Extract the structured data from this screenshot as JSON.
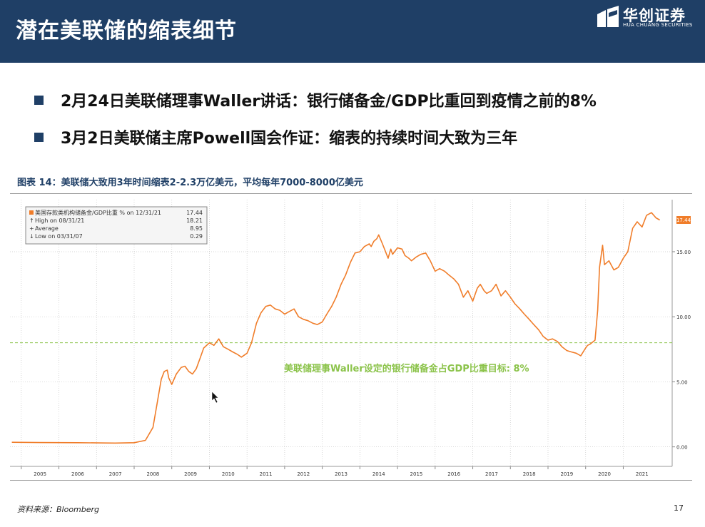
{
  "header": {
    "title": "潜在美联储的缩表细节",
    "logo_cn": "华创证券",
    "logo_en": "HUA CHUANG SECURITIES",
    "bg_color": "#1f3f66"
  },
  "bullets": [
    "2月24日美联储理事Waller讲话：银行储备金/GDP比重回到疫情之前的8%",
    "3月2日美联储主席Powell国会作证：缩表的持续时间大致为三年"
  ],
  "figure_caption": "图表 14：美联储大致用3年时间缩表2-2.3万亿美元，平均每年7000-8000亿美元",
  "chart_data": {
    "type": "line",
    "legend": {
      "series_label": "美国存款类机构储备金/GDP比重 % on 12/31/21",
      "last_value": "17.44",
      "high_label": "High on 08/31/21",
      "high_value": "18.21",
      "avg_label": "Average",
      "avg_value": "8.95",
      "low_label": "Low on 03/31/07",
      "low_value": "0.29"
    },
    "x_ticks": [
      "2005",
      "2006",
      "2007",
      "2008",
      "2009",
      "2010",
      "2011",
      "2012",
      "2013",
      "2014",
      "2015",
      "2016",
      "2017",
      "2018",
      "2019",
      "2020",
      "2021"
    ],
    "y_ticks": [
      "0.00",
      "5.00",
      "10.00",
      "15.00"
    ],
    "ylim": [
      -1.5,
      19.0
    ],
    "xlim": [
      2004.7,
      2022.3
    ],
    "target_value": 8,
    "target_label": "美联储理事Waller设定的银行储备金占GDP比重目标: 8%",
    "last_value_tag": "17.44",
    "series_color": "#f07d2a",
    "target_color": "#8bc34a",
    "series": [
      {
        "x": [
          2004.75,
          2005.5,
          2006.5,
          2007.25,
          2007.5,
          2008.0,
          2008.3,
          2008.5,
          2008.62,
          2008.72,
          2008.8,
          2008.88,
          2008.92,
          2009.0,
          2009.12,
          2009.25,
          2009.35,
          2009.45,
          2009.55,
          2009.65,
          2009.75,
          2009.85,
          2010.0,
          2010.12,
          2010.25,
          2010.37,
          2010.5,
          2010.62,
          2010.75,
          2010.85,
          2011.0,
          2011.12,
          2011.25,
          2011.37,
          2011.5,
          2011.62,
          2011.75,
          2011.87,
          2012.0,
          2012.12,
          2012.25,
          2012.37,
          2012.5,
          2012.62,
          2012.75,
          2012.87,
          2013.0,
          2013.12,
          2013.25,
          2013.37,
          2013.5,
          2013.62,
          2013.75,
          2013.87,
          2014.0,
          2014.12,
          2014.25,
          2014.3,
          2014.37,
          2014.45,
          2014.5,
          2014.6,
          2014.75,
          2014.82,
          2014.87,
          2015.0,
          2015.12,
          2015.2,
          2015.3,
          2015.37,
          2015.5,
          2015.62,
          2015.75,
          2015.87,
          2016.0,
          2016.12,
          2016.25,
          2016.37,
          2016.5,
          2016.62,
          2016.75,
          2016.87,
          2017.0,
          2017.12,
          2017.2,
          2017.3,
          2017.37,
          2017.5,
          2017.62,
          2017.75,
          2017.87,
          2018.0,
          2018.12,
          2018.25,
          2018.37,
          2018.5,
          2018.62,
          2018.75,
          2018.87,
          2019.0,
          2019.12,
          2019.25,
          2019.37,
          2019.5,
          2019.62,
          2019.75,
          2019.87,
          2020.0,
          2020.05,
          2020.12,
          2020.25,
          2020.32,
          2020.37,
          2020.45,
          2020.5,
          2020.62,
          2020.75,
          2020.87,
          2021.0,
          2021.12,
          2021.25,
          2021.37,
          2021.5,
          2021.62,
          2021.75,
          2021.87,
          2021.97
        ],
        "y": [
          0.35,
          0.33,
          0.32,
          0.3,
          0.29,
          0.32,
          0.5,
          1.5,
          3.5,
          5.2,
          5.8,
          5.9,
          5.3,
          4.8,
          5.6,
          6.1,
          6.2,
          5.8,
          5.6,
          6.0,
          6.8,
          7.6,
          8.0,
          7.8,
          8.3,
          7.7,
          7.5,
          7.3,
          7.1,
          6.9,
          7.2,
          8.0,
          9.5,
          10.3,
          10.8,
          10.9,
          10.6,
          10.5,
          10.2,
          10.4,
          10.6,
          10.0,
          9.8,
          9.7,
          9.5,
          9.4,
          9.6,
          10.2,
          10.8,
          11.5,
          12.5,
          13.2,
          14.2,
          14.9,
          15.0,
          15.4,
          15.6,
          15.4,
          15.8,
          16.0,
          16.3,
          15.6,
          14.5,
          15.2,
          14.8,
          15.3,
          15.2,
          14.7,
          14.5,
          14.3,
          14.6,
          14.8,
          14.9,
          14.3,
          13.5,
          13.7,
          13.5,
          13.2,
          12.9,
          12.5,
          11.5,
          12.0,
          11.2,
          12.2,
          12.5,
          12.0,
          11.8,
          12.0,
          12.5,
          11.6,
          12.0,
          11.5,
          11.0,
          10.6,
          10.2,
          9.8,
          9.4,
          9.0,
          8.5,
          8.2,
          8.3,
          8.1,
          7.7,
          7.4,
          7.3,
          7.2,
          7.0,
          7.6,
          7.8,
          7.9,
          8.2,
          10.5,
          13.8,
          15.5,
          14.0,
          14.3,
          13.6,
          13.8,
          14.5,
          15.0,
          16.8,
          17.3,
          16.9,
          17.8,
          18.0,
          17.6,
          17.44
        ]
      }
    ]
  },
  "source": "资料来源：Bloomberg",
  "page_number": "17"
}
